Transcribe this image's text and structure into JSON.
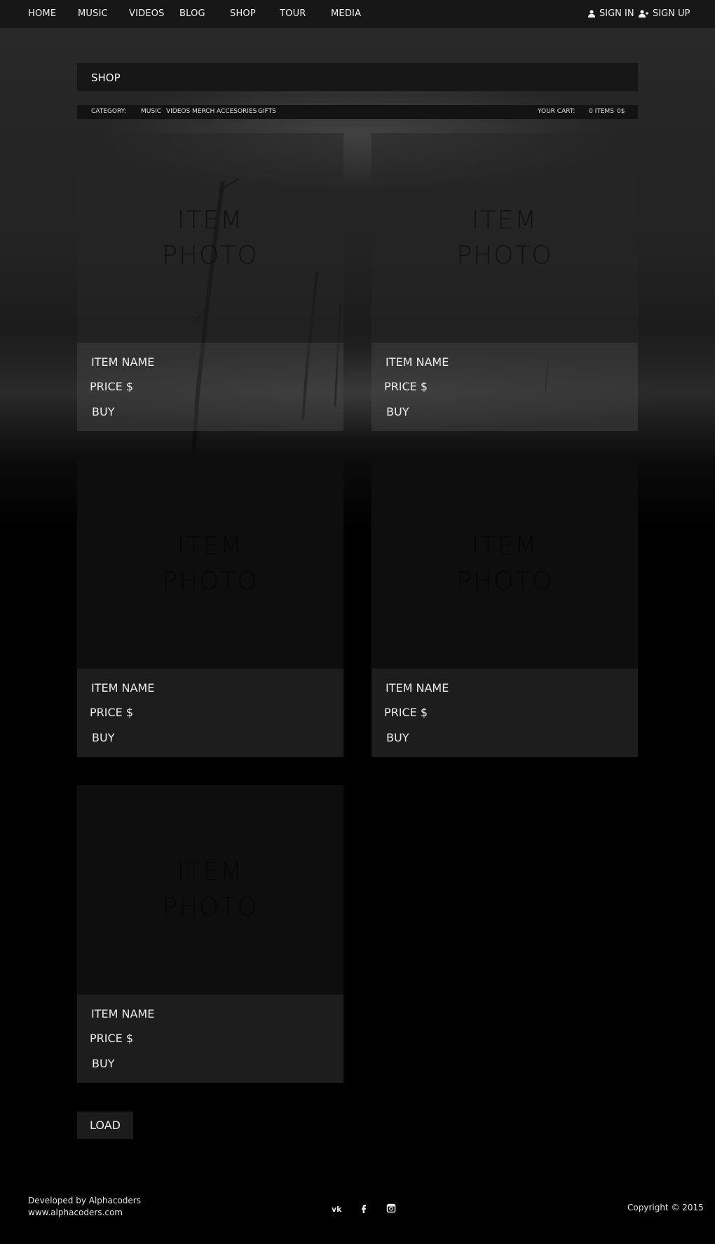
{
  "nav": {
    "items": [
      "HOME",
      "MUSIC",
      "VIDEOS",
      "BLOG",
      "SHOP",
      "TOUR",
      "MEDIA"
    ],
    "sign_in": "SIGN IN",
    "sign_up": "SIGN UP"
  },
  "shop": {
    "title": "SHOP",
    "category_label": "CATEGORY:",
    "categories": [
      "MUSIC",
      "VIDEOS",
      "MERCH",
      "ACCESORIES",
      "GIFTS"
    ],
    "cart_label": "YOUR CART:",
    "cart_items": "0 ITEMS",
    "cart_total": "0$"
  },
  "products": [
    {
      "photo_line1": "ITEM",
      "photo_line2": "PHOTO",
      "name": "ITEM NAME",
      "price": "PRICE $",
      "buy": "BUY"
    },
    {
      "photo_line1": "ITEM",
      "photo_line2": "PHOTO",
      "name": "ITEM NAME",
      "price": "PRICE $",
      "buy": "BUY"
    },
    {
      "photo_line1": "ITEM",
      "photo_line2": "PHOTO",
      "name": "ITEM NAME",
      "price": "PRICE $",
      "buy": "BUY"
    },
    {
      "photo_line1": "ITEM",
      "photo_line2": "PHOTO",
      "name": "ITEM NAME",
      "price": "PRICE $",
      "buy": "BUY"
    },
    {
      "photo_line1": "ITEM",
      "photo_line2": "PHOTO",
      "name": "ITEM NAME",
      "price": "PRICE $",
      "buy": "BUY"
    }
  ],
  "load_label": "LOAD",
  "footer": {
    "developer": "Developed by Alphacoders",
    "website": "www.alphacoders.com",
    "copyright": "Copyright © 2015",
    "social_icons": [
      "vk-icon",
      "facebook-icon",
      "instagram-icon"
    ]
  }
}
